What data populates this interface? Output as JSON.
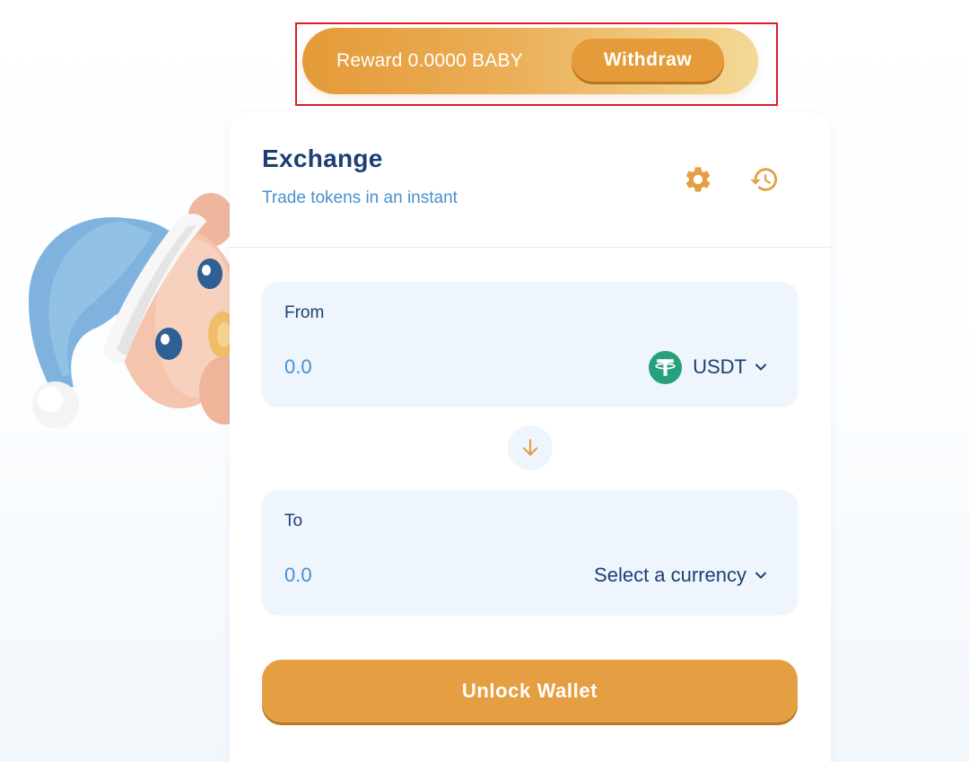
{
  "reward": {
    "label": "Reward 0.0000 BABY",
    "withdraw_label": "Withdraw"
  },
  "exchange": {
    "title": "Exchange",
    "subtitle": "Trade tokens in an instant",
    "icons": {
      "settings": "gear-icon",
      "history": "history-icon"
    }
  },
  "from": {
    "label": "From",
    "amount": "0.0",
    "currency": "USDT",
    "token_icon": "usdt-token-icon"
  },
  "swap": {
    "icon": "arrow-down-icon"
  },
  "to": {
    "label": "To",
    "amount": "0.0",
    "currency": "Select a currency"
  },
  "actions": {
    "unlock_label": "Unlock Wallet"
  },
  "colors": {
    "brand_orange": "#e69e42",
    "navy": "#1d3f73",
    "link_blue": "#4a8fcf",
    "panel_bg": "#eef5fc",
    "usdt_green": "#26a17b",
    "highlight_red": "#e11d25"
  }
}
